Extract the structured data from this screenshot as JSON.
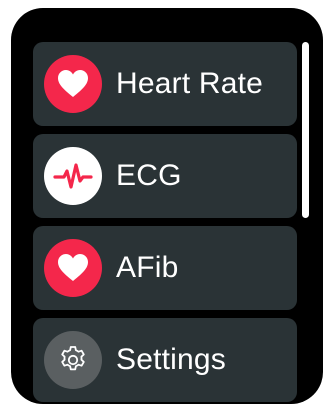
{
  "menu": {
    "items": [
      {
        "label": "Heart Rate",
        "icon": "heart-icon",
        "icon_bg": "#f4274b"
      },
      {
        "label": "ECG",
        "icon": "ecg-waveform-icon",
        "icon_bg": "#ffffff"
      },
      {
        "label": "AFib",
        "icon": "heart-icon",
        "icon_bg": "#f4274b"
      },
      {
        "label": "Settings",
        "icon": "gear-icon",
        "icon_bg": "#5a5f61"
      }
    ]
  },
  "colors": {
    "watch_bg": "#000000",
    "card_bg": "#2a3336",
    "accent_red": "#f4274b",
    "text": "#ffffff"
  }
}
